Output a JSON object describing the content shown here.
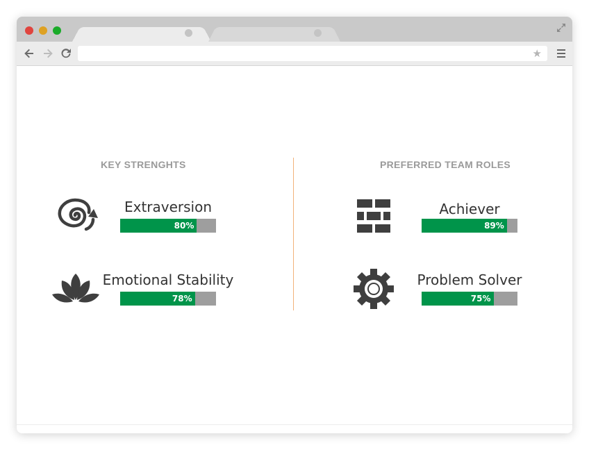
{
  "browser": {
    "address_value": "",
    "icons": [
      "back-arrow-icon",
      "forward-arrow-icon",
      "reload-icon",
      "star-icon",
      "menu-icon",
      "fullscreen-icon"
    ],
    "star_glyph": "★"
  },
  "left_section": {
    "title": "KEY STRENGHTS",
    "items": [
      {
        "label": "Extraversion",
        "percent": 80,
        "value_text": "80%",
        "icon": "spiral-arrow-icon"
      },
      {
        "label": "Emotional Stability",
        "percent": 78,
        "value_text": "78%",
        "icon": "lotus-icon"
      }
    ]
  },
  "right_section": {
    "title": "PREFERRED TEAM ROLES",
    "items": [
      {
        "label": "Achiever",
        "percent": 89,
        "value_text": "89%",
        "icon": "brick-wall-icon"
      },
      {
        "label": "Problem Solver",
        "percent": 75,
        "value_text": "75%",
        "icon": "gear-icon"
      }
    ]
  },
  "colors": {
    "bar_fill": "#00944a",
    "bar_track": "#9e9e9e",
    "divider": "#f2b27a",
    "icon": "#3f3f3f",
    "section_title": "#9a9a9a"
  }
}
